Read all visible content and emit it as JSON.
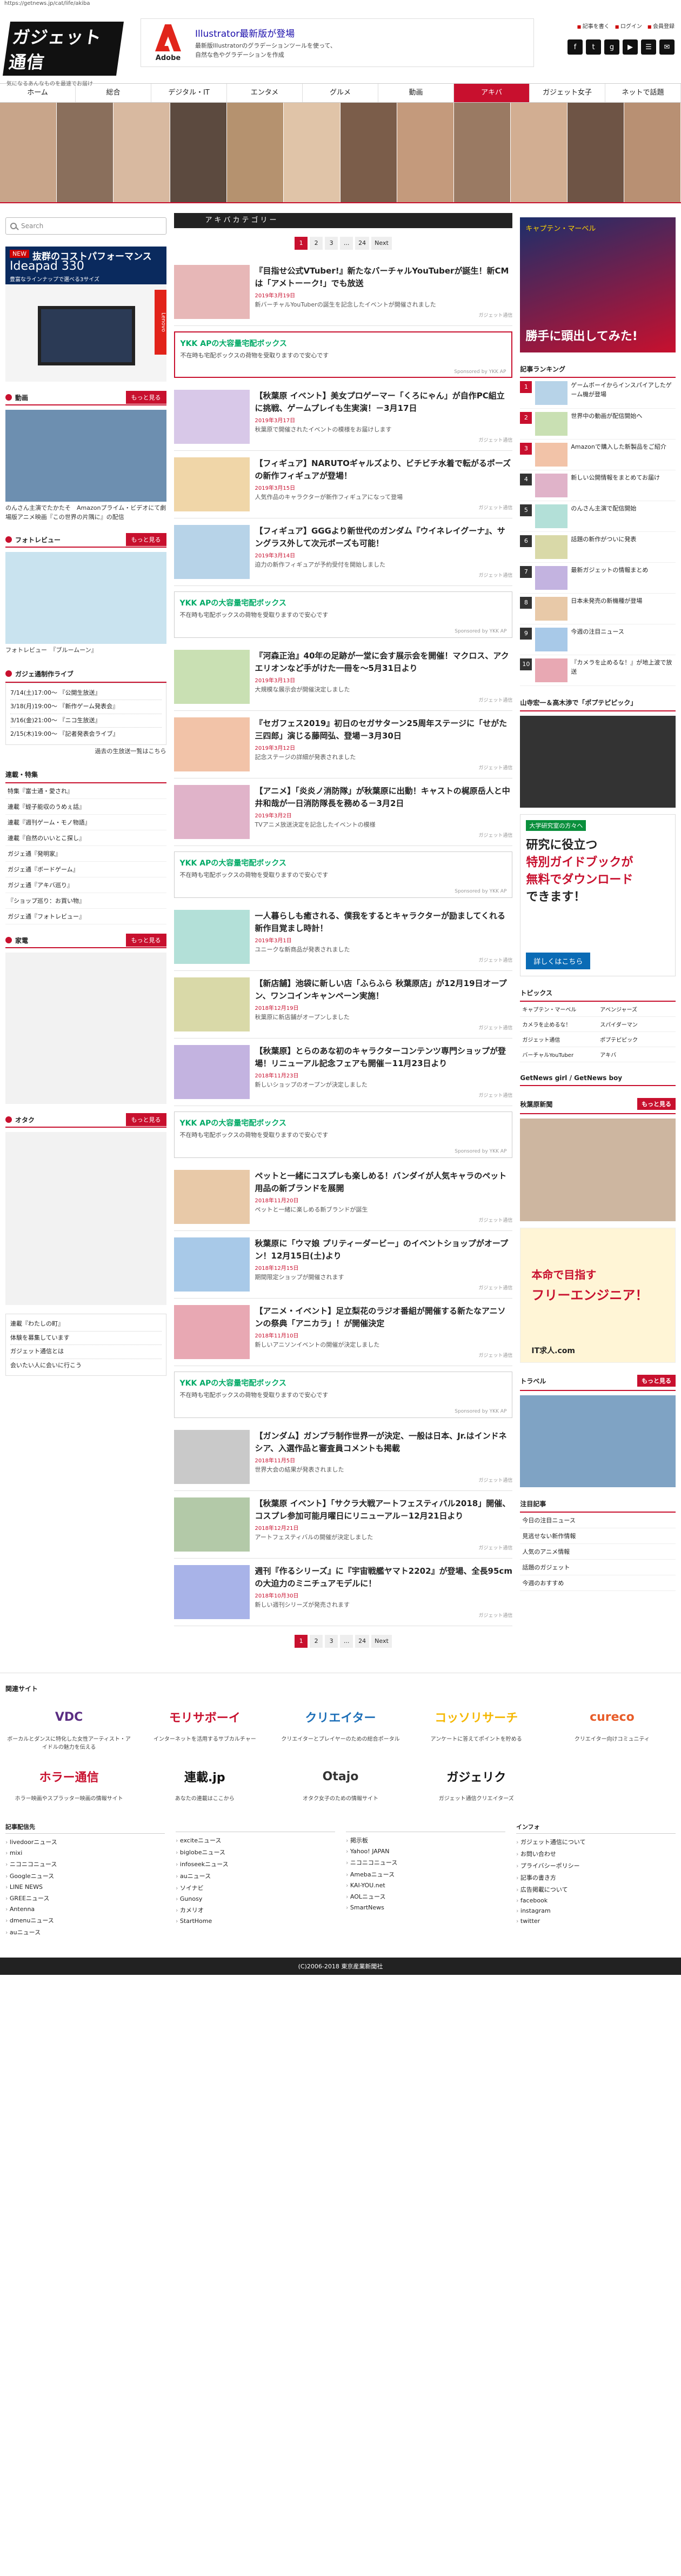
{
  "url": "https://getnews.jp/cat/life/akiba",
  "header": {
    "logo_text": "ガジェット通信",
    "tagline": "気になるあんなものを最速でお届け",
    "ad": {
      "brand": "Adobe",
      "headline": "Illustrator最新版が登場",
      "line1": "最新版Illustratorのグラデーションツールを使って、",
      "line2": "自然な色やグラデーションを作成"
    },
    "links": [
      "記事を書く",
      "ログイン",
      "会員登録"
    ],
    "sns": [
      "f",
      "t",
      "g",
      "▶",
      "☰",
      "✉"
    ]
  },
  "nav": [
    {
      "label": "ホーム",
      "active": false
    },
    {
      "label": "総合",
      "active": false
    },
    {
      "label": "デジタル・IT",
      "active": false
    },
    {
      "label": "エンタメ",
      "active": false
    },
    {
      "label": "グルメ",
      "active": false
    },
    {
      "label": "動画",
      "active": false
    },
    {
      "label": "アキバ",
      "active": true
    },
    {
      "label": "ガジェット女子",
      "active": false
    },
    {
      "label": "ネットで話題",
      "active": false
    }
  ],
  "left": {
    "search_placeholder": "Search",
    "ad": {
      "badge": "NEW",
      "title": "抜群のコストパフォーマンス",
      "model": "Ideapad 330",
      "sub": "豊富なラインナップで選べる3サイズ",
      "brand": "Lenovo"
    },
    "douga": {
      "title": "動画",
      "more": "もっと見る",
      "caption": "のんさん主演でたかたそ　Amazonプライム・ビデオにて劇場版アニメ映画『この世界の片隅に』の配信"
    },
    "photo": {
      "title": "フォトレビュー",
      "more": "もっと見る",
      "caption": "フォトレビュー　『ブルームーン』"
    },
    "live": {
      "title": "ガジェ通制作ライブ",
      "items": [
        "7/14(土)17:00〜 『公開生放送』",
        "3/18(月)19:00〜 『新作ゲーム発表会』",
        "3/16(金)21:00〜 『ニコ生放送』",
        "2/15(木)19:00〜 『記者発表会ライブ』"
      ],
      "more": "過去の生放送一覧はこちら"
    },
    "feature": {
      "title": "連載・特集",
      "items": [
        "特集『富士通・愛され』",
        "連載『蛭子能収のうめぇ話』",
        "連載『週刊ゲーム・モノ物語』",
        "連載『自然のいいとこ探し』",
        "ガジェ通『発明家』",
        "ガジェ通『ボードゲーム』",
        "ガジェ通『アキバ巡り』",
        "『ショップ巡り：お買い物』",
        "ガジェ通『フォトレビュー』"
      ]
    },
    "kaden": {
      "title": "家電",
      "more": "もっと見る"
    },
    "otaku": {
      "title": "オタク",
      "more": "もっと見る"
    },
    "qa": {
      "items": [
        "連載『わたしの町』",
        "体験を募集しています",
        "ガジェット通信とは",
        "会いたい人に会いに行こう"
      ]
    }
  },
  "main": {
    "category_title": "アキバカテゴリー",
    "pager": [
      "1",
      "2",
      "3",
      "...",
      "24",
      "Next"
    ],
    "articles": [
      {
        "title": "『目指せ公式VTuber!』新たなバーチャルYouTuberが誕生！新CMは「アメトーーク!」でも放送",
        "meta": "2019年3月19日",
        "desc": "新バーチャルYouTuberの誕生を記念したイベントが開催されました",
        "foot": "ガジェット通信"
      },
      {
        "title": "【秋葉原 イベント】美女プロゲーマー「くろにゃん」が自作PC組立に挑戦、ゲームプレイも生実演！－3月17日",
        "meta": "2019年3月17日",
        "desc": "秋葉原で開催されたイベントの模様をお届けします",
        "foot": "ガジェット通信"
      },
      {
        "title": "【フィギュア】NARUTOギャルズより、ビチビチ水着で転がるポーズの新作フィギュアが登場！",
        "meta": "2019年3月15日",
        "desc": "人気作品のキャラクターが新作フィギュアになって登場",
        "foot": "ガジェット通信"
      },
      {
        "title": "【フィギュア】GGGより新世代のガンダム『ウイネレイグーナ』、サングラス外して次元ポーズも可能！",
        "meta": "2019年3月14日",
        "desc": "迫力の新作フィギュアが予約受付を開始しました",
        "foot": "ガジェット通信"
      },
      {
        "title": "『河森正治』40年の足跡が一堂に会す展示会を開催！マクロス、アクエリオンなど手がけた一冊を〜5月31日より",
        "meta": "2019年3月13日",
        "desc": "大規模な展示会が開催決定しました",
        "foot": "ガジェット通信"
      },
      {
        "title": "『セガフェス2019』初日のセガサターン25周年ステージに「せがた三四郎」演じる藤岡弘、登場－3月30日",
        "meta": "2019年3月12日",
        "desc": "記念ステージの詳細が発表されました",
        "foot": "ガジェット通信"
      },
      {
        "title": "【アニメ】「炎炎ノ消防隊」が秋葉原に出動！キャストの梶原岳人と中井和哉が一日消防隊長を務める－3月2日",
        "meta": "2019年3月2日",
        "desc": "TVアニメ放送決定を記念したイベントの模様",
        "foot": "ガジェット通信"
      },
      {
        "title": "一人暮らしも癒される、僕我をするとキャラクターが励ましてくれる新作目覚まし時計！",
        "meta": "2019年3月1日",
        "desc": "ユニークな新商品が発表されました",
        "foot": "ガジェット通信"
      },
      {
        "title": "【新店舗】池袋に新しい店「ふらふら 秋葉原店」が12月19日オープン、ワンコインキャンペーン実施！",
        "meta": "2018年12月19日",
        "desc": "秋葉原に新店舗がオープンしました",
        "foot": "ガジェット通信"
      },
      {
        "title": "【秋葉原】とらのあな初のキャラクターコンテンツ専門ショップが登場！リニューアル記念フェアも開催－11月23日より",
        "meta": "2018年11月23日",
        "desc": "新しいショップのオープンが決定しました",
        "foot": "ガジェット通信"
      },
      {
        "title": "ペットと一緒にコスプレも楽しめる！バンダイが人気キャラのペット用品の新ブランドを展開",
        "meta": "2018年11月20日",
        "desc": "ペットと一緒に楽しめる新ブランドが誕生",
        "foot": "ガジェット通信"
      },
      {
        "title": "秋葉原に「ウマ娘 プリティーダービー」のイベントショップがオープン！12月15日(土)より",
        "meta": "2018年12月15日",
        "desc": "期間限定ショップが開催されます",
        "foot": "ガジェット通信"
      },
      {
        "title": "【アニメ・イベント】足立梨花のラジオ番組が開催する新たなアニソンの祭典「アニカラ」！が開催決定",
        "meta": "2018年11月10日",
        "desc": "新しいアニソンイベントの開催が決定しました",
        "foot": "ガジェット通信"
      },
      {
        "title": "【ガンダム】ガンプラ制作世界一が決定、一般は日本、Jr.はインドネシア、入選作品と審査員コメントも掲載",
        "meta": "2018年11月5日",
        "desc": "世界大会の結果が発表されました",
        "foot": "ガジェット通信"
      },
      {
        "title": "【秋葉原 イベント】「サクラ大戦アートフェスティバル2018」開催、コスプレ参加可能月曜日にリニューアル－12月21日より",
        "meta": "2018年12月21日",
        "desc": "アートフェスティバルの開催が決定しました",
        "foot": "ガジェット通信"
      },
      {
        "title": "週刊『作るシリーズ』に『宇宙戦艦ヤマト2202』が登場、全長95cmの大迫力のミニチュアモデルに！",
        "meta": "2018年10月30日",
        "desc": "新しい週刊シリーズが発売されます",
        "foot": "ガジェット通信"
      }
    ],
    "promo": {
      "title": "YKK APの大容量宅配ボックス",
      "sub": "不在時も宅配ボックスの荷物を受取りますので安心です",
      "foot": "Sponsored by YKK AP"
    }
  },
  "right": {
    "movie_ad": {
      "title": "勝手に頭出してみた!",
      "sub": "キャプテン・マーベル"
    },
    "ranking": {
      "title": "記事ランキング",
      "items": [
        "ゲームボーイからインスパイアしたゲーム機が登場",
        "世界中の動画が配信開始へ",
        "Amazonで購入した新製品をご紹介",
        "新しい公開情報をまとめてお届け",
        "のんさん主演で配信開始",
        "話題の新作がついに発表",
        "最新ガジェットの情報まとめ",
        "日本未発売の新機種が登場",
        "今週の注目ニュース",
        "『カメラを止めるな！』が地上波で放送"
      ]
    },
    "creator": {
      "title": "山寺宏一＆高木渉で「ポプテピピック」"
    },
    "ad2": {
      "badge": "大学研究室の方々へ",
      "line1": "研究に役立つ",
      "line2": "特別ガイドブックが",
      "line3": "無料でダウンロード",
      "line4": "できます！",
      "cta": "詳しくはこちら"
    },
    "topics": {
      "title": "トピックス",
      "items": [
        "キャプテン・マーベル",
        "アベンジャーズ",
        "カメラを止めるな！",
        "スパイダーマン",
        "ガジェット通信",
        "ポプテピピック",
        "バーチャルYouTuber",
        "アキバ"
      ]
    },
    "getnews_girl": {
      "title": "GetNews girl / GetNews boy"
    },
    "akiba_news": {
      "title": "秋葉原新聞",
      "more": "もっと見る"
    },
    "ad3": {
      "line1": "本命で目指す",
      "line2": "フリーエンジニア！",
      "brand": "IT求人.com"
    },
    "travel": {
      "title": "トラベル",
      "more": "もっと見る"
    },
    "rankbox": {
      "title": "注目記事",
      "items": [
        "今日の注目ニュース",
        "見逃せない新作情報",
        "人気のアニメ情報",
        "話題のガジェット",
        "今週のおすすめ"
      ]
    }
  },
  "footer": {
    "related_title": "関連サイト",
    "logos": [
      {
        "name": "VDC",
        "caption": "ボーカルとダンスに特化した女性アーティスト・アイドルの魅力を伝える"
      },
      {
        "name": "モリサボーイ",
        "caption": "インターネットを活用するサブカルチャー"
      },
      {
        "name": "クリエイター",
        "caption": "クリエイターとプレイヤーのための総合ポータル"
      },
      {
        "name": "コッソリサーチ",
        "caption": "アンケートに答えてポイントを貯める"
      },
      {
        "name": "cureco",
        "caption": "クリエイター向けコミュニティ"
      },
      {
        "name": "ホラー通信",
        "caption": "ホラー映画やスプラッター映画の情報サイト"
      },
      {
        "name": "連載.jp",
        "caption": "あなたの連載はここから"
      },
      {
        "name": "Otajo",
        "caption": "オタク女子のための情報サイト"
      },
      {
        "name": "ガジェリク",
        "caption": "ガジェット通信クリエイターズ"
      },
      {
        "name": "",
        "caption": ""
      }
    ],
    "cols": [
      {
        "title": "記事配信先",
        "items": [
          "livedoorニュース",
          "mixi",
          "ニコニコニュース",
          "Googleニュース",
          "LINE NEWS",
          "GREEニュース",
          "Antenna",
          "dmenuニュース",
          "auニュース"
        ]
      },
      {
        "title": "",
        "items": [
          "exciteニュース",
          "biglobeニュース",
          "infoseekニュース",
          "auニュース",
          "ソイナビ",
          "Gunosy",
          "カメリオ",
          "StartHome"
        ]
      },
      {
        "title": "",
        "items": [
          "掲示板",
          "Yahoo! JAPAN",
          "ニコニコニュース",
          "Amebaニュース",
          "KAI-YOU.net",
          "AOLニュース",
          "SmartNews"
        ]
      },
      {
        "title": "インフォ",
        "items": [
          "ガジェット通信について",
          "お問い合わせ",
          "プライバシーポリシー",
          "記事の書き方",
          "広告掲載について",
          "facebook",
          "instagram",
          "twitter"
        ]
      }
    ],
    "copyright": "(C)2006-2018 東京産業新聞社"
  }
}
